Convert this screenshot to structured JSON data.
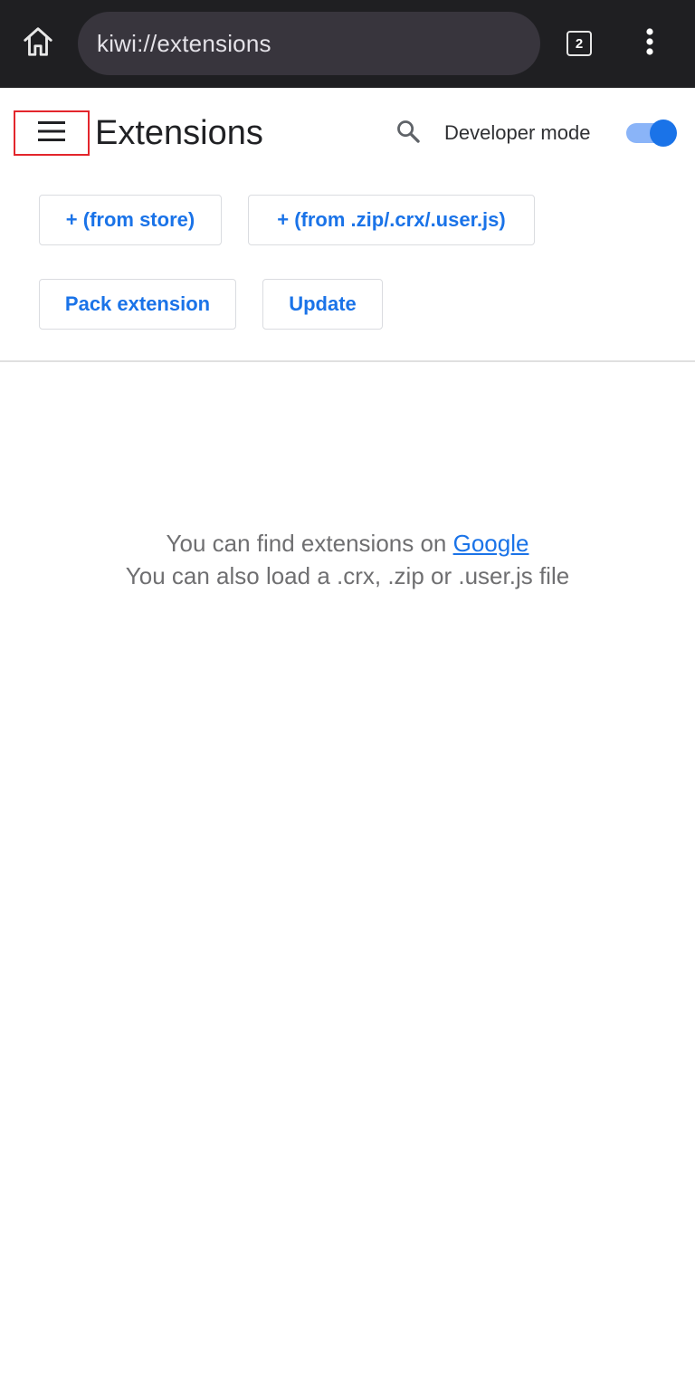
{
  "browser": {
    "url": "kiwi://extensions",
    "tab_count": "2",
    "icons": {
      "home": "home-icon",
      "tabs": "tab-switcher-icon",
      "menu": "more-vertical-icon"
    }
  },
  "header": {
    "title": "Extensions",
    "developer_mode_label": "Developer mode",
    "developer_mode_enabled": true,
    "icons": {
      "menu": "hamburger-menu-icon",
      "search": "search-icon"
    }
  },
  "toolbar": {
    "from_store_label": "+ (from store)",
    "from_file_label": "+ (from .zip/.crx/.user.js)",
    "pack_label": "Pack extension",
    "update_label": "Update"
  },
  "empty_state": {
    "line1_prefix": "You can find extensions on ",
    "line1_link": "Google",
    "line2": "You can also load a .crx, .zip or .user.js file"
  },
  "colors": {
    "accent": "#1a73e8",
    "toggle_track": "#8ab4f8",
    "highlight_border": "#e3262c",
    "browser_bar": "#1f1f22"
  }
}
